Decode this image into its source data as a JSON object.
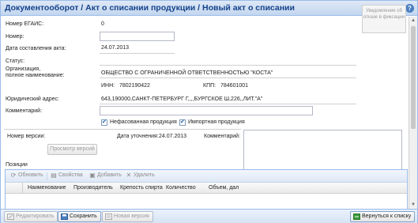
{
  "window": {
    "title": "Документооборот / Акт о списании продукции / Новый акт о списании",
    "help": "?"
  },
  "side_button": {
    "label": "Уведомление об отказе в фиксации"
  },
  "form": {
    "egais_label": "Номер ЕГАИС:",
    "egais_value": "0",
    "number_label": "Номер:",
    "number_value": "",
    "date_label": "Дата составления акта:",
    "date_value": "24.07.2013",
    "status_label": "Статус:",
    "status_value": "",
    "org_label_1": "Организация,",
    "org_label_2": "полное наименование:",
    "org_value": "ОБЩЕСТВО С ОГРАНИЧЕННОЙ ОТВЕТСТВЕННОСТЬЮ \"КОСТА\"",
    "inn_label": "ИНН:",
    "inn_value": "7802190422",
    "kpp_label": "КПП:",
    "kpp_value": "784601001",
    "address_label": "Юридический адрес:",
    "address_value": "643,190000,САНКТ-ПЕТЕРБУРГ Г,,,,БУРГСКОЕ Ш,226,,ЛИТ.\"А\"",
    "comment_label": "Комментарий:",
    "comment_value": "",
    "checkbox_unpacked": "Нефасованная продукция",
    "checkbox_import": "Импортная продукция"
  },
  "version": {
    "version_label": "Номер версии:",
    "version_value": "",
    "refine_date_label": "Дата уточнения:",
    "refine_date_value": "24.07.2013",
    "comment_label": "Комментарий:",
    "view_versions_button": "Просмотр версий"
  },
  "positions": {
    "label": "Позиции",
    "toolbar": {
      "refresh": "Обновить",
      "properties": "Свойства",
      "add": "Добавить",
      "delete": "Удалить"
    },
    "columns": [
      "Наименование",
      "Производитель",
      "Крепость спирта",
      "Количество",
      "Объем, дал"
    ]
  },
  "footer": {
    "edit": "Редактировать",
    "save": "Сохранить",
    "new_version": "Новая версия",
    "back": "Вернуться к списку"
  },
  "colors": {
    "title_text": "#15428b",
    "border_blue": "#99bbe8",
    "back_icon": "#3a9a3a"
  }
}
